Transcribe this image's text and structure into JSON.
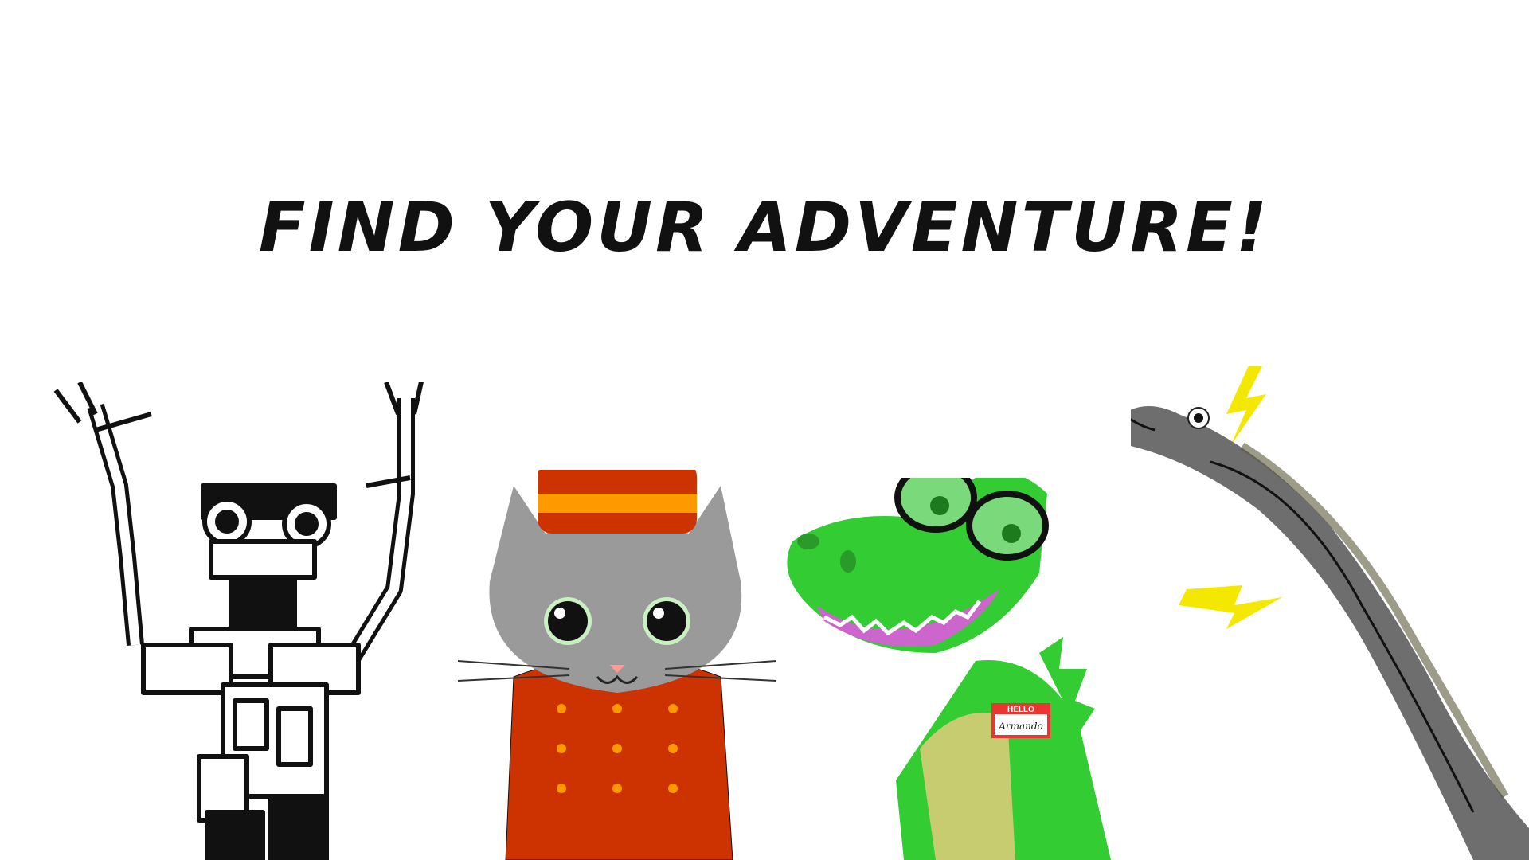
{
  "headline": "FIND YOUR ADVENTURE!",
  "characters": [
    {
      "name": "robot"
    },
    {
      "name": "cat-bellhop"
    },
    {
      "name": "crocodile"
    },
    {
      "name": "eel"
    }
  ],
  "name_tag": {
    "header": "HELLO",
    "name": "Armando"
  },
  "colors": {
    "background": "#ffffff",
    "text": "#111111",
    "cat_fur": "#9a9a9a",
    "bellhop_red": "#cc3300",
    "bellhop_orange": "#ff9900",
    "croc_green": "#33cc33",
    "croc_belly": "#c8cc70",
    "eel_gray": "#6e6e6e",
    "lightning": "#f5e800"
  }
}
